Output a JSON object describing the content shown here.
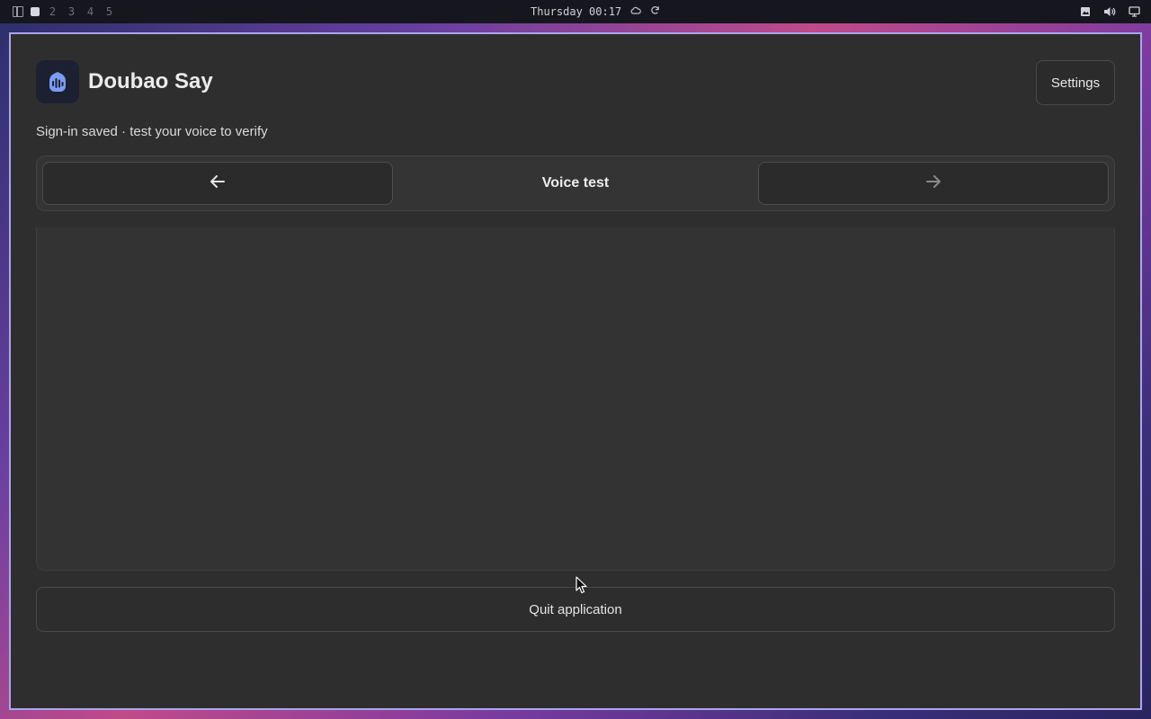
{
  "topbar": {
    "workspaces": [
      "2",
      "3",
      "4",
      "5"
    ],
    "clock": "Thursday 00:17",
    "icons": [
      "workspace-layout-icon",
      "cloud-icon",
      "refresh-icon",
      "screenshot-icon",
      "volume-icon",
      "display-icon"
    ]
  },
  "app": {
    "title": "Doubao Say",
    "icon": "voice-wave-icon",
    "settings_label": "Settings",
    "subtitle": "Sign-in saved · test your voice to verify"
  },
  "nav": {
    "title": "Voice test",
    "back_icon": "arrow-left-icon",
    "forward_icon": "arrow-right-icon"
  },
  "footer": {
    "quit_label": "Quit application"
  },
  "colors": {
    "window_border": "#a9a6ee",
    "window_bg": "#2f2e2e",
    "app_icon_accent": "#7b9df5"
  }
}
